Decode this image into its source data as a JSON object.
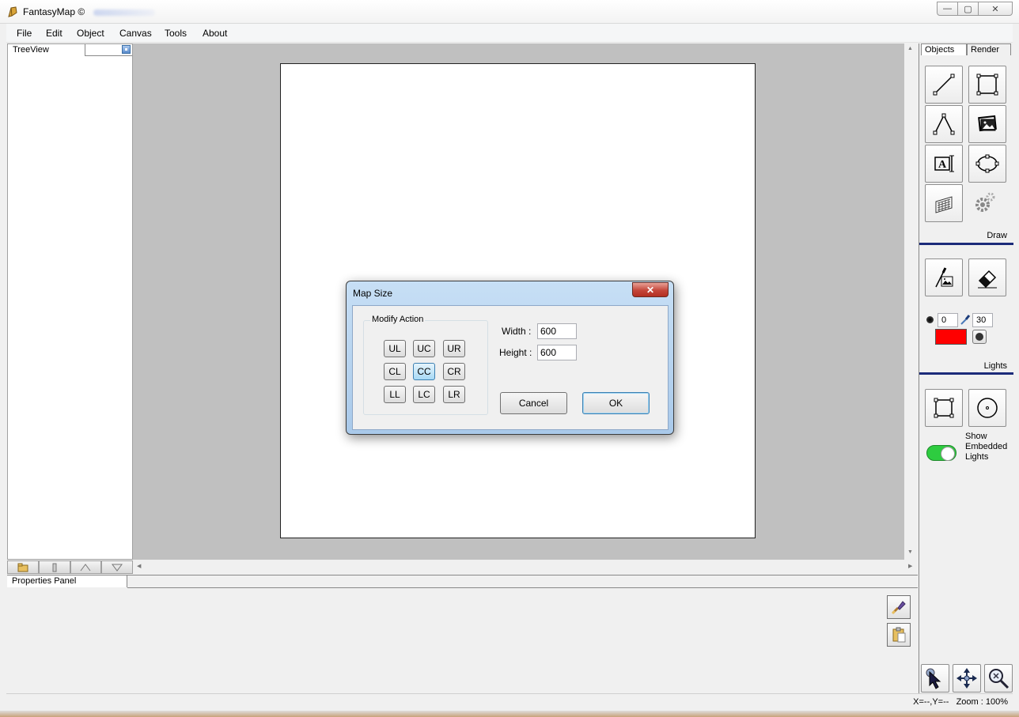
{
  "window": {
    "title": "FantasyMap ©",
    "controls": {
      "minimize": "—",
      "maximize": "▢",
      "close": "✕"
    }
  },
  "menu": [
    "File",
    "Edit",
    "Object",
    "Canvas",
    "Tools",
    "About"
  ],
  "treeview": {
    "tab_label": "TreeView",
    "buttons": [
      "folder-icon",
      "column-icon",
      "move-up-icon",
      "move-down-icon"
    ]
  },
  "properties_panel": {
    "tab_label": "Properties Panel",
    "buttons": [
      "brush-icon",
      "clipboard-icon"
    ]
  },
  "right_panel": {
    "tabs": [
      "Objects",
      "Render"
    ],
    "draw_label": "Draw",
    "draw_tools": [
      "line-icon",
      "rectangle-icon",
      "polyline-icon",
      "image-icon",
      "text-icon",
      "ellipse-icon",
      "pattern-icon",
      "gears-icon"
    ],
    "lights_tools": [
      "paint-image-icon",
      "eraser-icon"
    ],
    "lights_label": "Lights",
    "brush_size": "0",
    "brush_radius": "30",
    "light_color": "#ff0000",
    "embedded_tools": [
      "selection-rect-icon",
      "circle-icon"
    ],
    "show_embedded_lights_label": "Show Embedded Lights",
    "show_embedded_lights": true,
    "nav_tools": [
      "select-pointer-icon",
      "pan-icon",
      "zoom-icon"
    ]
  },
  "status": {
    "coords": "X=--,Y=--",
    "zoom": "Zoom : 100%"
  },
  "dialog": {
    "title": "Map Size",
    "close": "✕",
    "group_title": "Modify Action",
    "anchors": [
      [
        "UL",
        "UC",
        "UR"
      ],
      [
        "CL",
        "CC",
        "CR"
      ],
      [
        "LL",
        "LC",
        "LR"
      ]
    ],
    "selected_anchor": "CC",
    "width_label": "Width :",
    "width_value": "600",
    "height_label": "Height :",
    "height_value": "600",
    "cancel_label": "Cancel",
    "ok_label": "OK"
  }
}
